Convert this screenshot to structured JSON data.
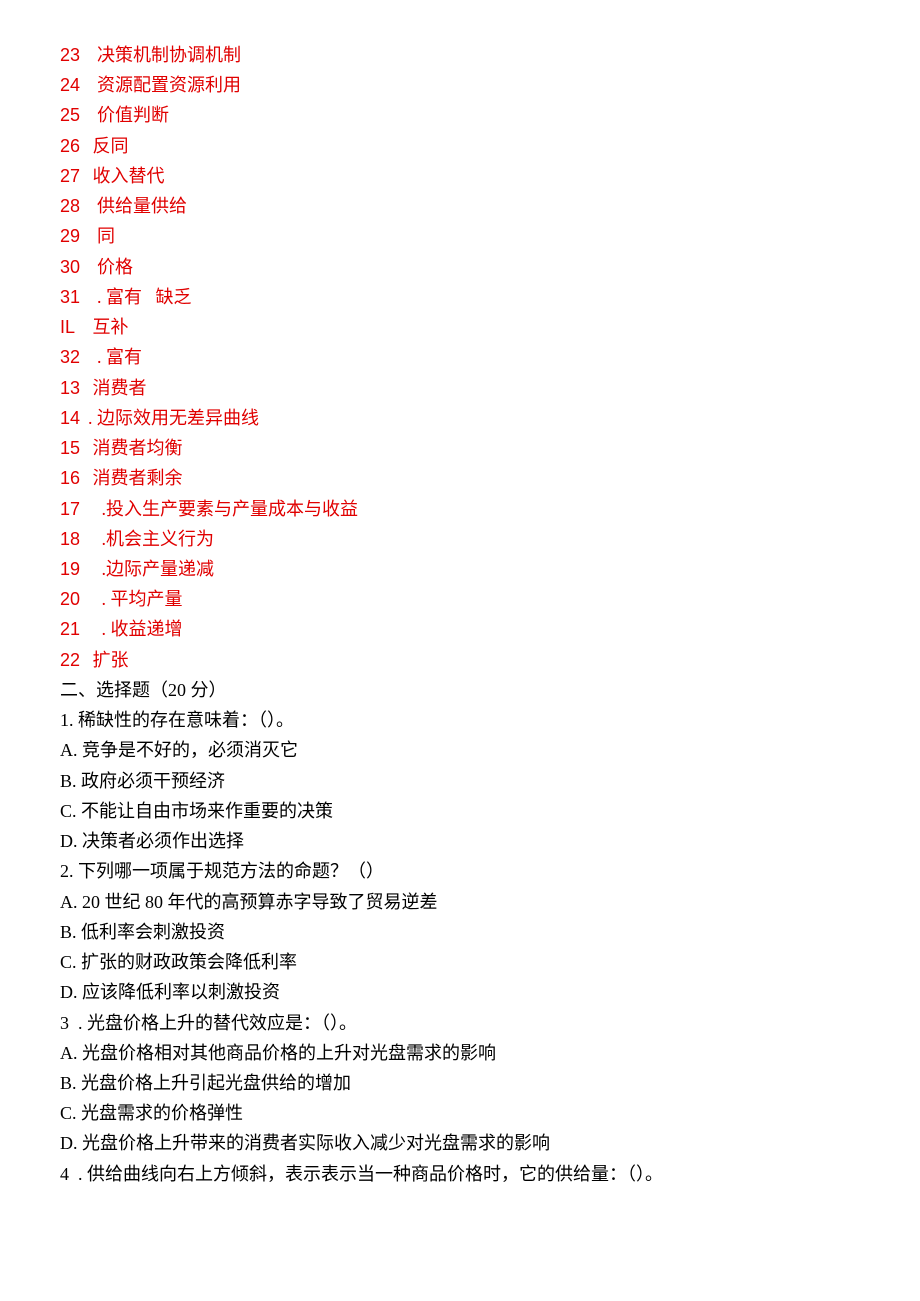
{
  "red_lines": [
    {
      "num": "23",
      "text": "  决策机制协调机制"
    },
    {
      "num": "24",
      "text": "  资源配置资源利用"
    },
    {
      "num": "25",
      "text": "  价值判断"
    },
    {
      "num": "26",
      "text": " 反同"
    },
    {
      "num": "27",
      "text": " 收入替代"
    },
    {
      "num": "28",
      "text": "  供给量供给"
    },
    {
      "num": "29",
      "text": "  同"
    },
    {
      "num": "30",
      "text": "  价格"
    },
    {
      "num": "31",
      "text": "  . 富有   缺乏"
    },
    {
      "num": "IL",
      "text": " 互补"
    },
    {
      "num": "32",
      "text": "  . 富有"
    },
    {
      "num": "13",
      "text": " 消费者"
    },
    {
      "num": "14",
      "text": ". 边际效用无差异曲线"
    },
    {
      "num": "15",
      "text": " 消费者均衡"
    },
    {
      "num": "16",
      "text": " 消费者剩余"
    },
    {
      "num": "17",
      "text": "   .投入生产要素与产量成本与收益"
    },
    {
      "num": "18",
      "text": "   .机会主义行为"
    },
    {
      "num": "19",
      "text": "   .边际产量递减"
    },
    {
      "num": "20",
      "text": "   . 平均产量"
    },
    {
      "num": "21",
      "text": "   . 收益递增"
    },
    {
      "num": "22",
      "text": " 扩张"
    }
  ],
  "black_lines": [
    "二、选择题（20 分）",
    "1. 稀缺性的存在意味着：（）。",
    "A. 竞争是不好的，必须消灭它",
    "B. 政府必须干预经济",
    "C. 不能让自由市场来作重要的决策",
    "D. 决策者必须作出选择",
    "2. 下列哪一项属于规范方法的命题？（）",
    "A. 20 世纪 80 年代的高预算赤字导致了贸易逆差",
    "B. 低利率会刺激投资",
    "C. 扩张的财政政策会降低利率",
    "D. 应该降低利率以刺激投资",
    "3  . 光盘价格上升的替代效应是：（）。",
    "A. 光盘价格相对其他商品价格的上升对光盘需求的影响",
    "B. 光盘价格上升引起光盘供给的增加",
    "C. 光盘需求的价格弹性",
    "D. 光盘价格上升带来的消费者实际收入减少对光盘需求的影响",
    "4  . 供给曲线向右上方倾斜，表示表示当一种商品价格时，它的供给量：（）。"
  ]
}
